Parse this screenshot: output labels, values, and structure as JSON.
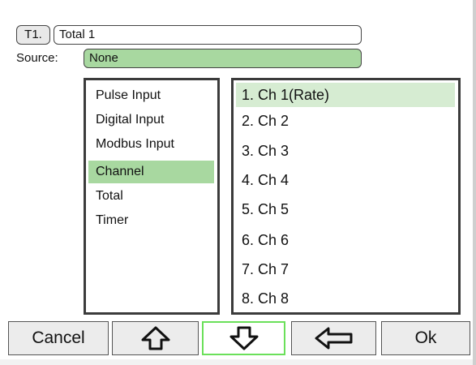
{
  "header": {
    "tag": "T1.",
    "name": "Total 1",
    "source_label": "Source:",
    "source_value": "None"
  },
  "sources": {
    "selected_index": 3,
    "items": [
      {
        "label": "Pulse Input"
      },
      {
        "label": "Digital Input"
      },
      {
        "label": "Modbus Input"
      },
      {
        "label": "Channel"
      },
      {
        "label": "Total"
      },
      {
        "label": "Timer"
      }
    ]
  },
  "channels": {
    "selected_index": 0,
    "items": [
      {
        "label": "1. Ch 1(Rate)"
      },
      {
        "label": "2. Ch 2"
      },
      {
        "label": "3. Ch 3"
      },
      {
        "label": "4. Ch 4"
      },
      {
        "label": "5. Ch 5"
      },
      {
        "label": "6. Ch 6"
      },
      {
        "label": "7. Ch 7"
      },
      {
        "label": "8. Ch 8"
      }
    ]
  },
  "buttons": {
    "cancel_label": "Cancel",
    "up_icon": "arrow-up-icon",
    "down_icon": "arrow-down-icon",
    "back_icon": "arrow-left-icon",
    "ok_label": "Ok",
    "active": "down"
  },
  "colors": {
    "selection_green": "#a8d8a0",
    "highlight_light_green": "#d6ecd2",
    "active_border": "#6be05a"
  }
}
